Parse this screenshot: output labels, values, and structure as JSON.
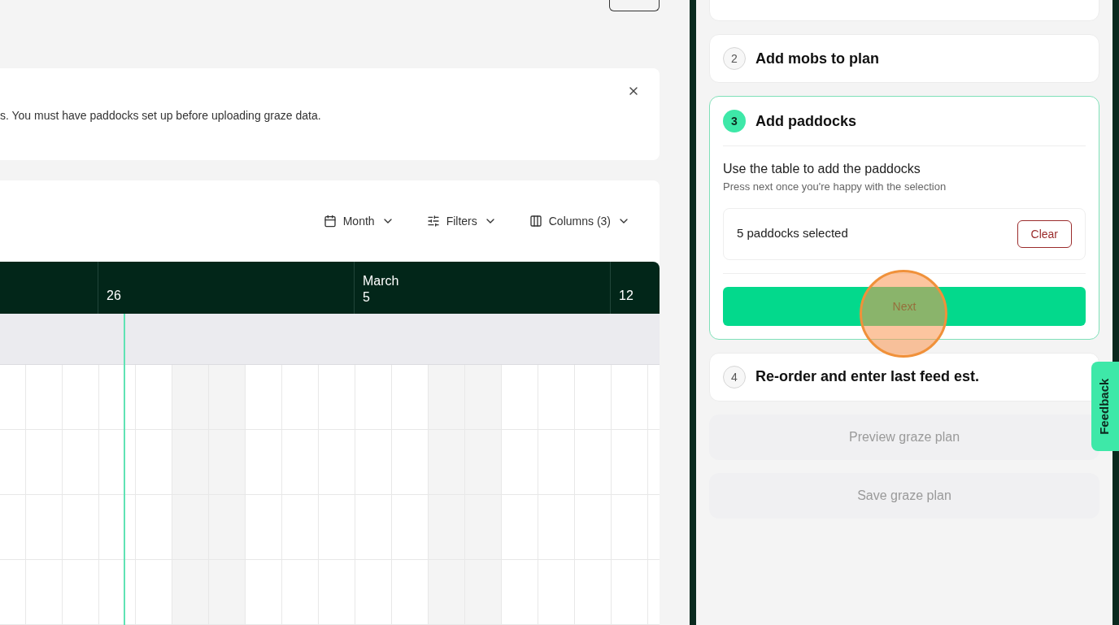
{
  "alert": {
    "text": "s. You must have paddocks set up before uploading graze data."
  },
  "toolbar": [
    {
      "kind": "calendar",
      "label": "Month"
    },
    {
      "kind": "filters",
      "label": "Filters"
    },
    {
      "kind": "columns",
      "label": "Columns (3)"
    }
  ],
  "timeline": {
    "weeks": [
      {
        "month": "March",
        "day": "5"
      }
    ],
    "lead_day": "26",
    "tail_day": "12"
  },
  "steps": [
    {
      "number": "2",
      "title": "Add mobs to plan",
      "selected": false
    },
    {
      "number": "3",
      "title": "Add paddocks",
      "selected": true,
      "heading": "Use the table to add the paddocks",
      "hint": "Press next once you're happy with the selection",
      "selection": "5 paddocks selected",
      "clear": "Clear",
      "next": "Next"
    },
    {
      "number": "4",
      "title": "Re-order and enter last feed est.",
      "selected": false
    }
  ],
  "actions": [
    {
      "label": "Preview graze plan",
      "disabled": true
    },
    {
      "label": "Save graze plan",
      "disabled": true
    }
  ],
  "feedback": "Feedback"
}
